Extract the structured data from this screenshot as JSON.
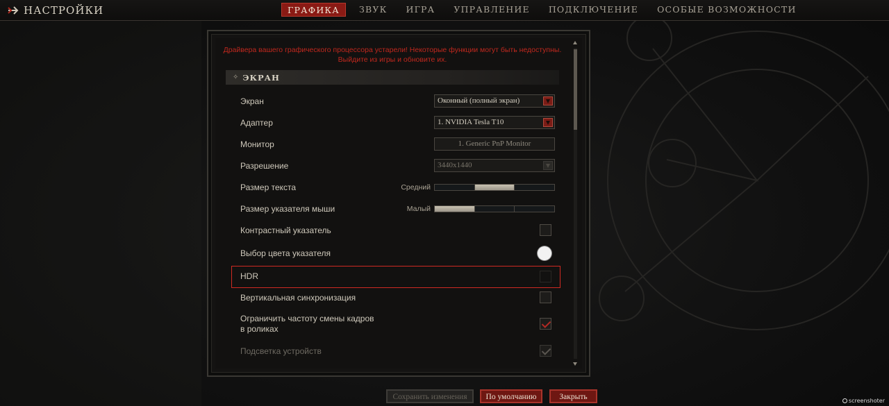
{
  "header": {
    "back_label": "НАСТРОЙКИ",
    "tabs": [
      {
        "label": "ГРАФИКА",
        "active": true
      },
      {
        "label": "ЗВУК",
        "active": false
      },
      {
        "label": "ИГРА",
        "active": false
      },
      {
        "label": "УПРАВЛЕНИЕ",
        "active": false
      },
      {
        "label": "ПОДКЛЮЧЕНИЕ",
        "active": false
      },
      {
        "label": "ОСОБЫЕ ВОЗМОЖНОСТИ",
        "active": false
      }
    ]
  },
  "panel": {
    "warning_line1": "Драйвера вашего графического процессора устарели! Некоторые функции могут быть недоступны.",
    "warning_line2": "Выйдите из игры и обновите их.",
    "section_title": "ЭКРАН",
    "settings": {
      "screen": {
        "label": "Экран",
        "value": "Оконный (полный экран)"
      },
      "adapter": {
        "label": "Адаптер",
        "value": "1. NVIDIA Tesla T10"
      },
      "monitor": {
        "label": "Монитор",
        "value": "1. Generic PnP Monitor"
      },
      "resolution": {
        "label": "Разрешение",
        "value": "3440x1440"
      },
      "text_size": {
        "label": "Размер текста",
        "value_label": "Средний",
        "level": 2,
        "steps": 3
      },
      "cursor_size": {
        "label": "Размер указателя мыши",
        "value_label": "Малый",
        "level": 1,
        "steps": 3
      },
      "contrast_cursor": {
        "label": "Контрастный указатель",
        "checked": false
      },
      "cursor_color": {
        "label": "Выбор цвета указателя",
        "color": "#f2f2f2"
      },
      "hdr": {
        "label": "HDR",
        "checked": false
      },
      "vsync": {
        "label": "Вертикальная синхронизация",
        "checked": false
      },
      "limit_fps": {
        "label_line1": "Ограничить частоту смены кадров",
        "label_line2": "в роликах",
        "checked": true
      },
      "device_lighting": {
        "label": "Подсветка устройств",
        "checked": true
      }
    }
  },
  "footer": {
    "save_label": "Сохранить изменения",
    "default_label": "По умолчанию",
    "close_label": "Закрыть"
  },
  "watermark": "screenshoter",
  "colors": {
    "accent": "#8a1a14",
    "warning": "#c0281e",
    "highlight": "#d02a22"
  }
}
